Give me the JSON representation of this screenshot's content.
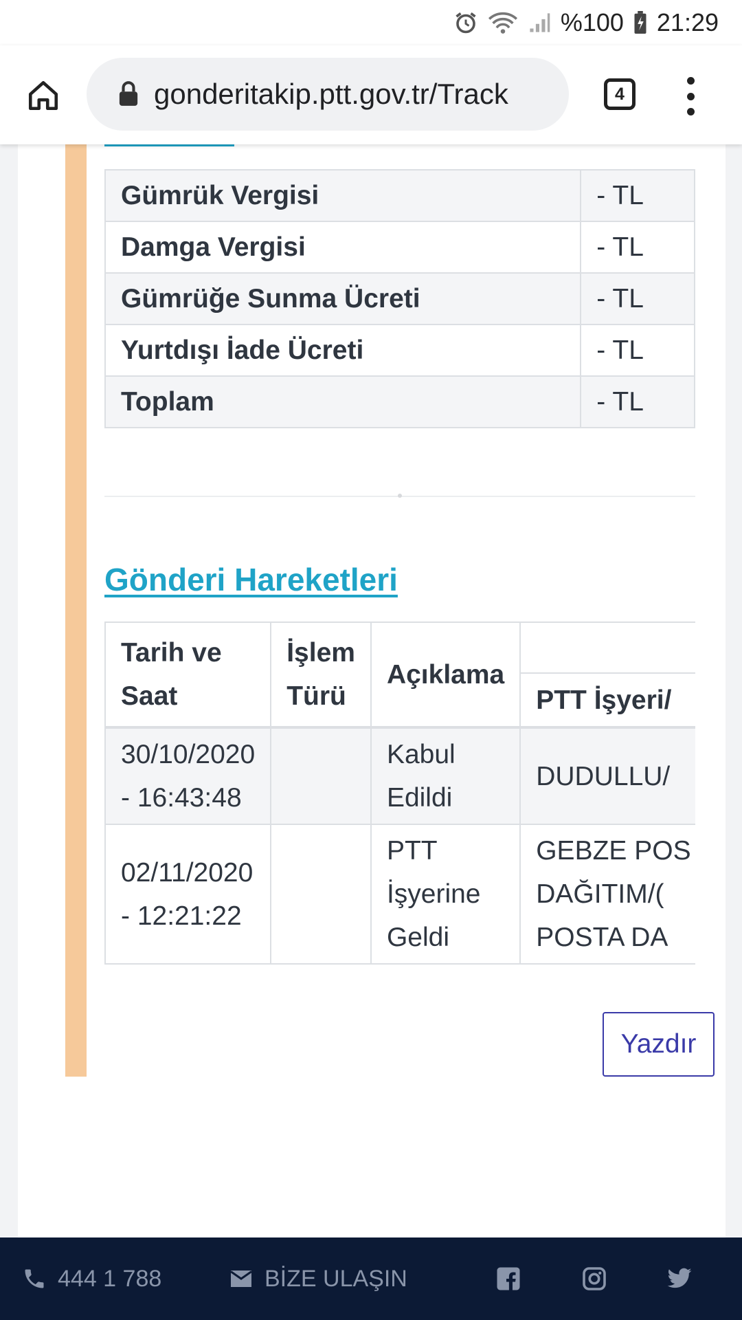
{
  "status_bar": {
    "battery": "%100",
    "time": "21:29"
  },
  "browser": {
    "url": "gonderitakip.ptt.gov.tr/Track",
    "tab_count": "4"
  },
  "fees": [
    {
      "label": "Gümrük Vergisi",
      "value": "- TL"
    },
    {
      "label": "Damga Vergisi",
      "value": "- TL"
    },
    {
      "label": "Gümrüğe Sunma Ücreti",
      "value": "- TL"
    },
    {
      "label": "Yurtdışı İade Ücreti",
      "value": "- TL"
    },
    {
      "label": "Toplam",
      "value": "- TL"
    }
  ],
  "movements": {
    "title": "Gönderi Hareketleri",
    "headers": {
      "date": "Tarih ve Saat",
      "type": "İşlem Türü",
      "description": "Açıklama",
      "office": "PTT İşyeri/"
    },
    "rows": [
      {
        "date": "30/10/2020 - 16:43:48",
        "type": "",
        "description": "Kabul Edildi",
        "office": "DUDULLU/"
      },
      {
        "date": "02/11/2020 - 12:21:22",
        "type": "",
        "description": "PTT İşyerine Geldi",
        "office": "GEBZE POS DAĞITIM/( POSTA DA"
      }
    ]
  },
  "print_button": "Yazdır",
  "footer": {
    "phone": "444 1 788",
    "contact": "BİZE ULAŞIN"
  }
}
